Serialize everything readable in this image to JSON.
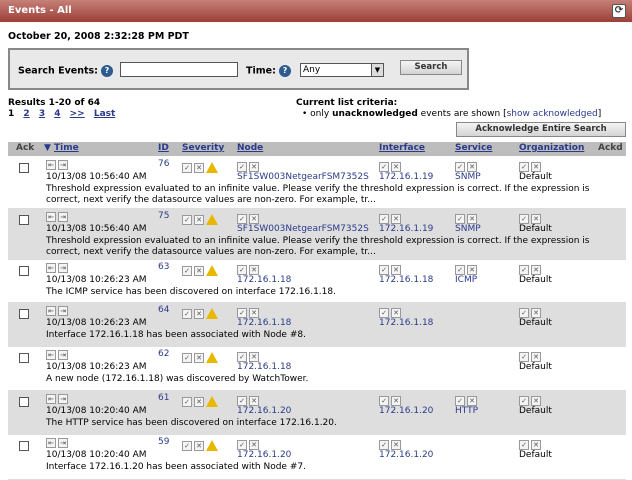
{
  "window": {
    "title": "Events - All",
    "refresh_icon": "refresh-icon"
  },
  "datetime": "October 20, 2008 2:32:28 PM PDT",
  "search": {
    "search_label": "Search Events:",
    "search_value": "",
    "time_label": "Time:",
    "time_value": "Any",
    "button_label": "Search"
  },
  "results": {
    "summary": "Results 1-20 of 64",
    "pages": [
      "1",
      "2",
      "3",
      "4",
      ">>",
      "Last"
    ]
  },
  "criteria": {
    "heading": "Current list criteria:",
    "prefix": "• only ",
    "bold": "unacknowledged",
    "middle": " events are shown [",
    "link": "show acknowledged",
    "suffix": "]"
  },
  "ack_all_label": "Acknowledge Entire Search",
  "columns": {
    "ack": "Ack",
    "time": "Time",
    "time_sort": "▼",
    "id": "ID",
    "severity": "Severity",
    "node": "Node",
    "interface": "Interface",
    "service": "Service",
    "organization": "Organization",
    "ackd": "Ackd"
  },
  "rows": [
    {
      "time": "10/13/08 10:56:40 AM",
      "id": "76",
      "warn": true,
      "node": "SF1SW003NetgearFSM7352S",
      "interface": "172.16.1.19",
      "service": "SNMP",
      "org": "Default",
      "msg": "Threshold expression evaluated to an infinite value. Please verify the threshold expression is correct. If the expression is correct, next verify the datasource values are non-zero. For example, tr..."
    },
    {
      "time": "10/13/08 10:56:40 AM",
      "id": "75",
      "warn": true,
      "node": "SF1SW003NetgearFSM7352S",
      "interface": "172.16.1.19",
      "service": "SNMP",
      "org": "Default",
      "msg": "Threshold expression evaluated to an infinite value. Please verify the threshold expression is correct. If the expression is correct, next verify the datasource values are non-zero. For example, tr..."
    },
    {
      "time": "10/13/08 10:26:23 AM",
      "id": "63",
      "warn": true,
      "node": "172.16.1.18",
      "interface": "172.16.1.18",
      "service": "ICMP",
      "org": "Default",
      "msg": "The ICMP service has been discovered on interface 172.16.1.18."
    },
    {
      "time": "10/13/08 10:26:23 AM",
      "id": "64",
      "warn": true,
      "node": "172.16.1.18",
      "interface": "172.16.1.18",
      "service": "",
      "org": "Default",
      "msg": "Interface 172.16.1.18 has been associated with Node #8."
    },
    {
      "time": "10/13/08 10:26:23 AM",
      "id": "62",
      "warn": true,
      "node": "172.16.1.18",
      "interface": "",
      "service": "",
      "org": "Default",
      "msg": "A new node (172.16.1.18) was discovered by WatchTower."
    },
    {
      "time": "10/13/08 10:20:40 AM",
      "id": "61",
      "warn": true,
      "node": "172.16.1.20",
      "interface": "172.16.1.20",
      "service": "HTTP",
      "org": "Default",
      "msg": "The HTTP service has been discovered on interface 172.16.1.20."
    },
    {
      "time": "10/13/08 10:20:40 AM",
      "id": "59",
      "warn": true,
      "node": "172.16.1.20",
      "interface": "172.16.1.20",
      "service": "",
      "org": "Default",
      "msg": "Interface 172.16.1.20 has been associated with Node #7."
    }
  ]
}
